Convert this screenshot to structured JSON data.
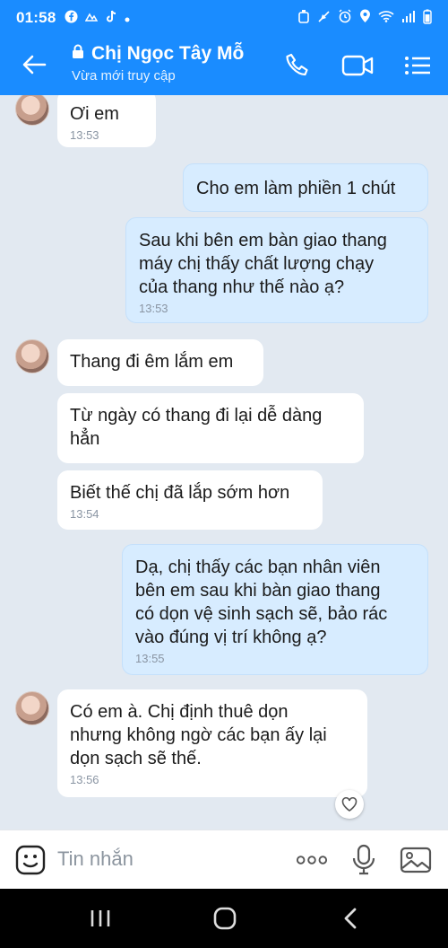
{
  "status_bar": {
    "time": "01:58",
    "left_icons": [
      "facebook-icon",
      "cloud-icon",
      "tiktok-icon",
      "dot-icon"
    ],
    "right_icons": [
      "sync-icon",
      "mute-icon",
      "alarm-icon",
      "location-icon",
      "wifi-icon",
      "signal-icon",
      "battery-icon"
    ]
  },
  "header": {
    "title": "Chị Ngọc Tây Mỗ",
    "subtitle": "Vừa mới truy cập",
    "accent": "#1a8cff"
  },
  "messages": [
    {
      "dir": "in",
      "lines": [
        "Ơi em"
      ],
      "time": "13:53",
      "avatar": true
    },
    {
      "dir": "out",
      "lines": [
        "Cho em làm phiền 1 chút"
      ],
      "time": ""
    },
    {
      "dir": "out",
      "lines": [
        "Sau khi bên em bàn giao thang",
        "máy chị thấy chất lượng chạy",
        "của thang như thế nào ạ?"
      ],
      "time": "13:53"
    },
    {
      "dir": "in",
      "lines": [
        "Thang đi êm lắm em"
      ],
      "time": "",
      "avatar": true
    },
    {
      "dir": "in",
      "lines": [
        "Từ ngày có thang đi lại dễ dàng",
        "hẳn"
      ],
      "time": ""
    },
    {
      "dir": "in",
      "lines": [
        "Biết thế chị đã lắp sớm hơn"
      ],
      "time": "13:54"
    },
    {
      "dir": "out",
      "lines": [
        "Dạ, chị thấy các bạn nhân viên",
        "bên em sau khi bàn giao thang",
        "có dọn vệ sinh sạch sẽ, bảo rác",
        "vào đúng vị trí không ạ?"
      ],
      "time": "13:55"
    },
    {
      "dir": "in",
      "lines": [
        "Có em à. Chị định thuê dọn",
        "nhưng không ngờ các bạn ấy lại",
        "dọn sạch sẽ thế."
      ],
      "time": "13:56",
      "avatar": true
    }
  ],
  "input": {
    "placeholder": "Tin nhắn"
  }
}
